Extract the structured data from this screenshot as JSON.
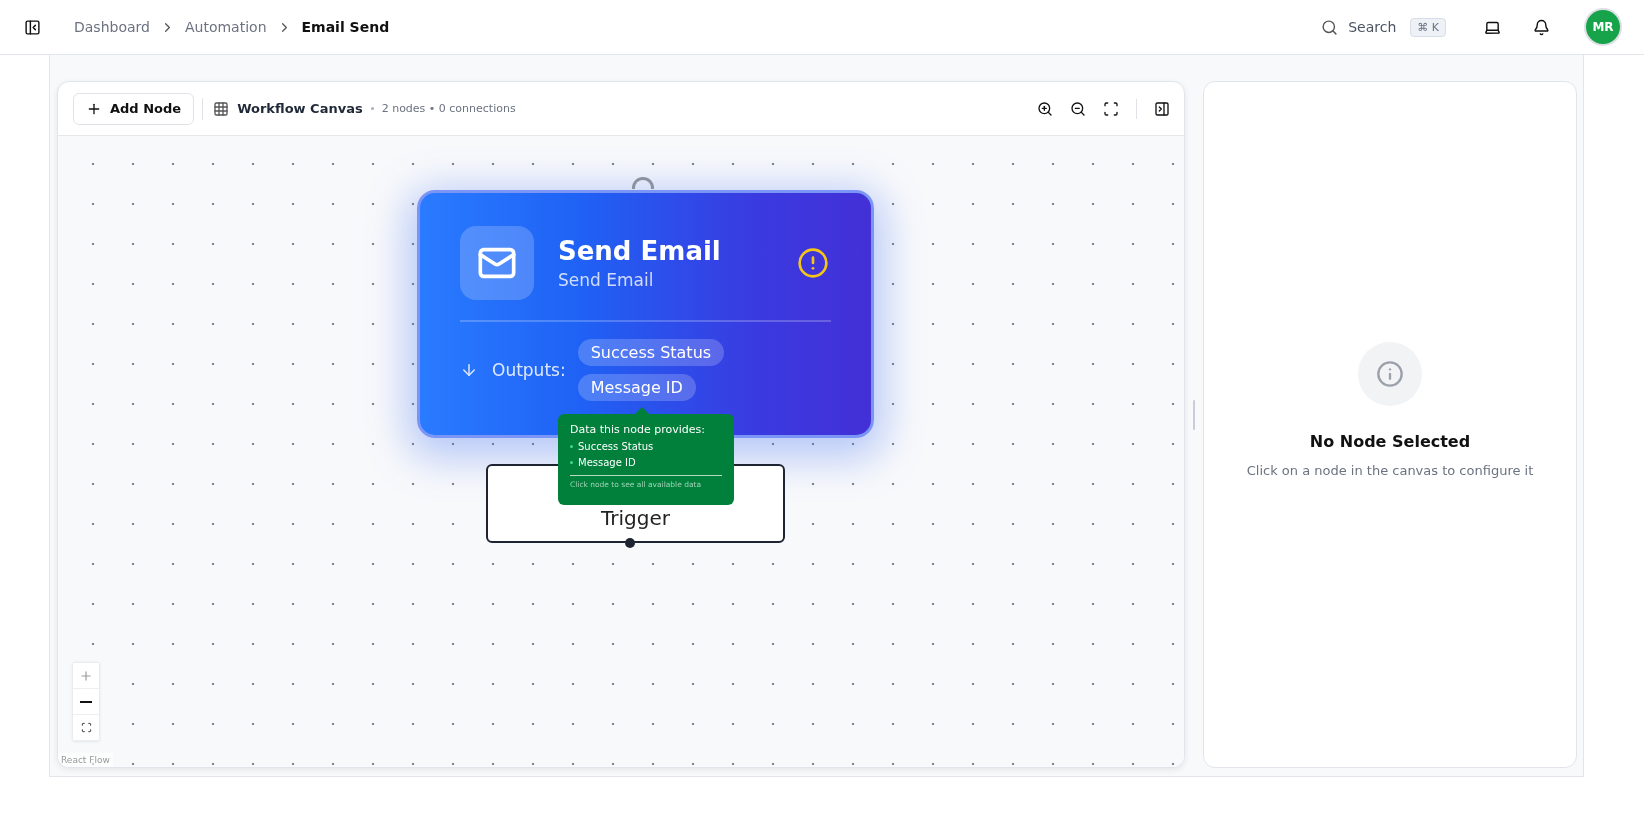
{
  "breadcrumbs": [
    {
      "label": "Dashboard",
      "current": false
    },
    {
      "label": "Automation",
      "current": false
    },
    {
      "label": "Email Send",
      "current": true
    }
  ],
  "header": {
    "search_label": "Search",
    "shortcut": "⌘ K",
    "avatar_initials": "MR"
  },
  "toolbar": {
    "add_button": "Add Node",
    "title": "Workflow Canvas",
    "summary": "2 nodes • 0 connections"
  },
  "nodes": [
    {
      "kind": "action",
      "title": "Send Email",
      "subtitle": "Send Email",
      "warning": true,
      "outputs_label": "Outputs:",
      "outputs": [
        "Success Status",
        "Message ID"
      ]
    },
    {
      "kind": "trigger",
      "title": "Trigger"
    }
  ],
  "tooltip": {
    "heading": "Data this node provides:",
    "items": [
      "Success Status",
      "Message ID"
    ],
    "footer": "Click node to see all available data"
  },
  "attribution": "React Flow",
  "details_panel": {
    "title": "No Node Selected",
    "message": "Click on a node in the canvas to configure it"
  }
}
